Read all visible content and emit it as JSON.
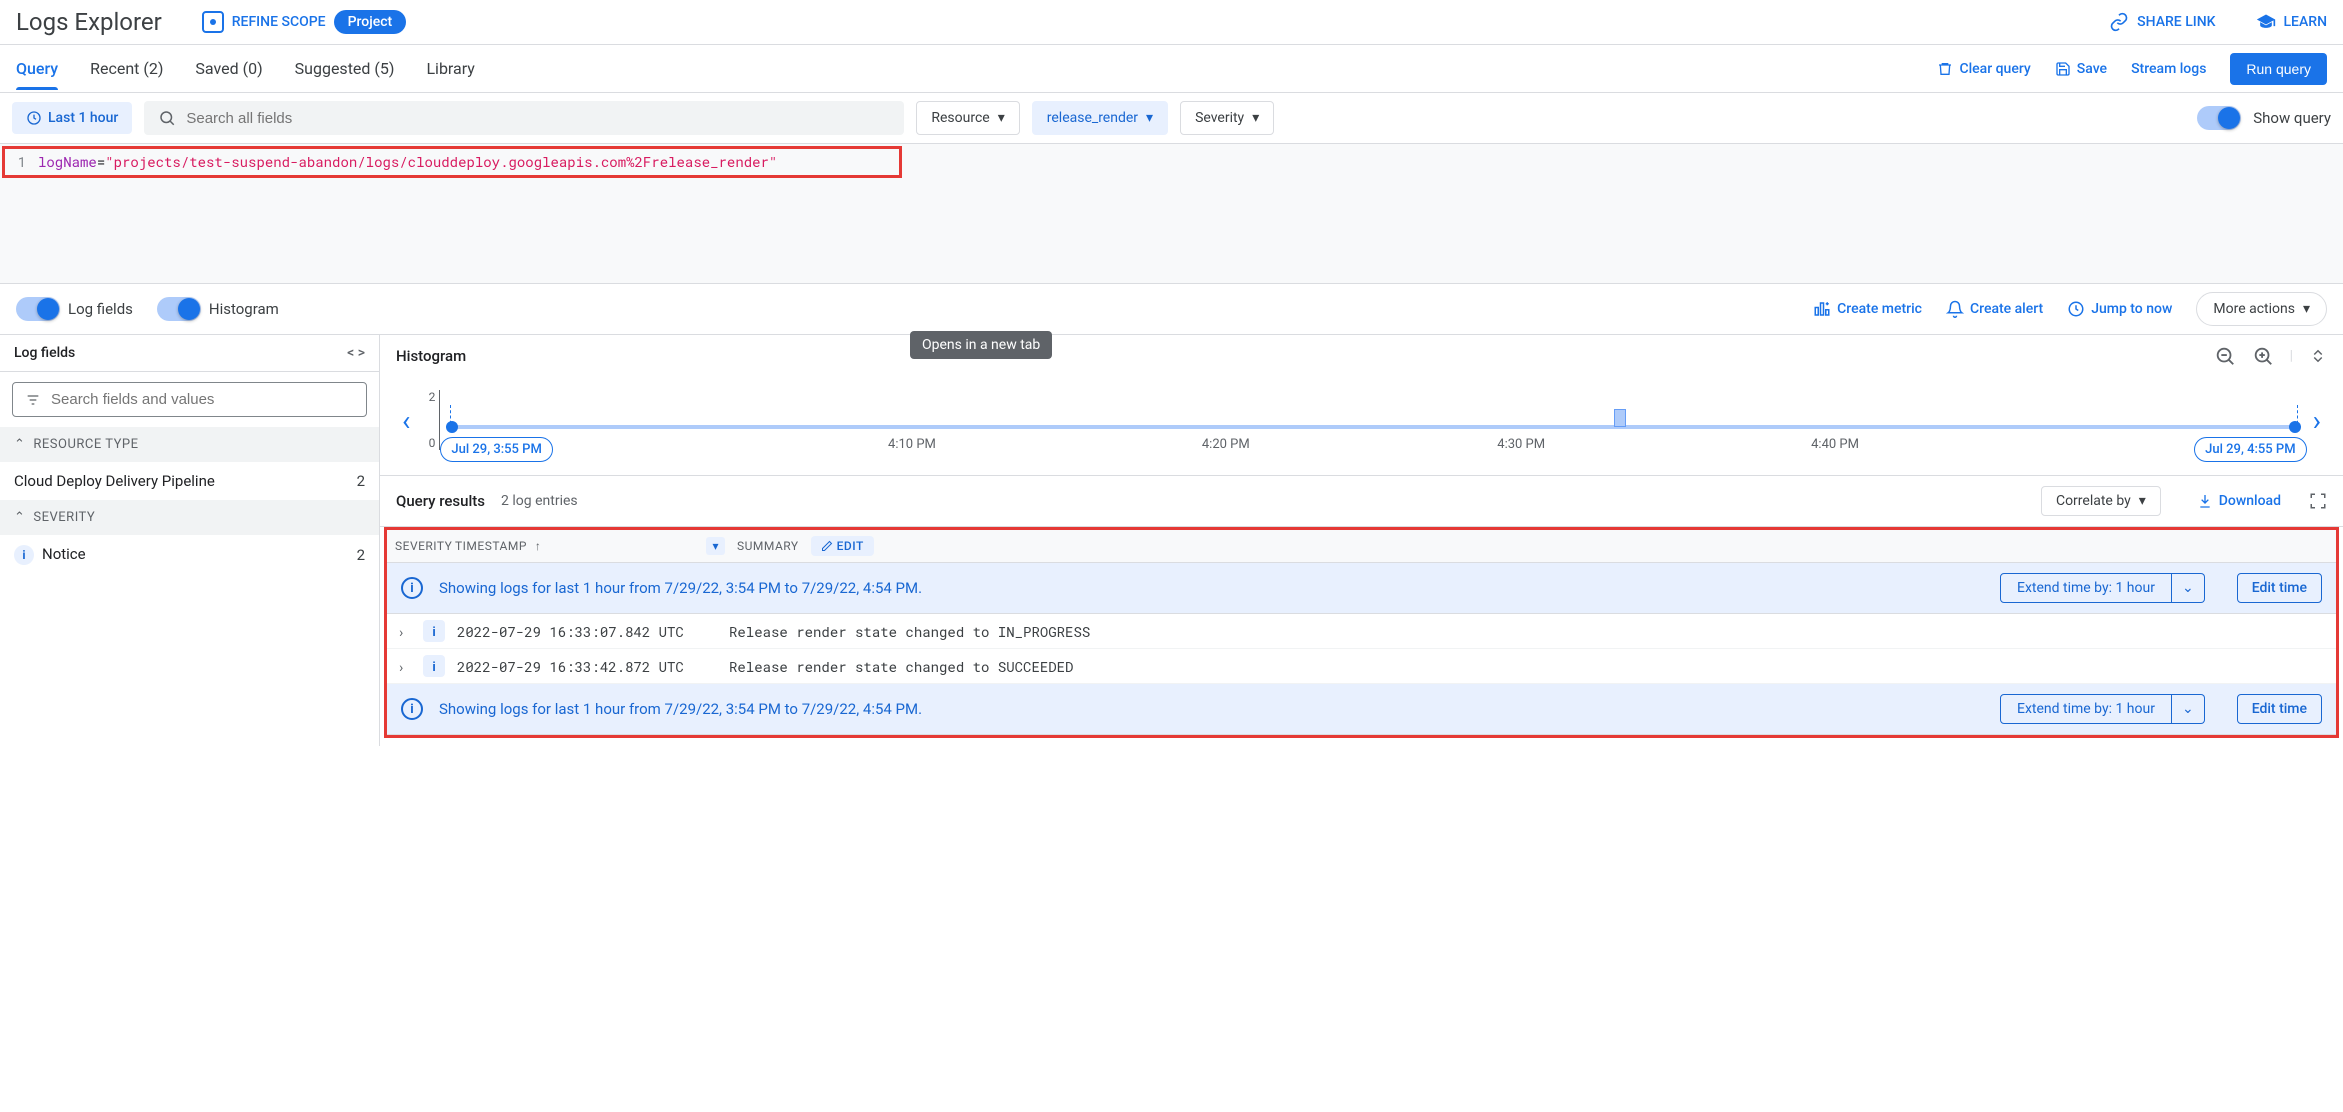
{
  "header": {
    "title": "Logs Explorer",
    "refine_scope": "REFINE SCOPE",
    "project_chip": "Project",
    "share_link": "SHARE LINK",
    "learn": "LEARN"
  },
  "tabs": {
    "query": "Query",
    "recent": "Recent (2)",
    "saved": "Saved (0)",
    "suggested": "Suggested (5)",
    "library": "Library"
  },
  "tabs_actions": {
    "clear_query": "Clear query",
    "save": "Save",
    "stream_logs": "Stream logs",
    "run_query": "Run query"
  },
  "filters": {
    "time_chip": "Last 1 hour",
    "search_placeholder": "Search all fields",
    "resource": "Resource",
    "log_name": "release_render",
    "severity": "Severity",
    "show_query": "Show query"
  },
  "query": {
    "line_num": "1",
    "keyword": "logName",
    "eq": "=",
    "value": "\"projects/test-suspend-abandon/logs/clouddeploy.googleapis.com%2Frelease_render\""
  },
  "toolbar": {
    "log_fields": "Log fields",
    "histogram": "Histogram",
    "create_metric": "Create metric",
    "create_alert": "Create alert",
    "jump_to_now": "Jump to now",
    "more_actions": "More actions"
  },
  "sidebar": {
    "title": "Log fields",
    "search_placeholder": "Search fields and values",
    "resource_type_header": "RESOURCE TYPE",
    "resource_type_value": "Cloud Deploy Delivery Pipeline",
    "resource_type_count": "2",
    "severity_header": "SEVERITY",
    "severity_value": "Notice",
    "severity_count": "2"
  },
  "histogram": {
    "title": "Histogram",
    "y_max": "2",
    "y_min": "0",
    "start_label": "Jul 29, 3:55 PM",
    "end_label": "Jul 29, 4:55 PM",
    "ticks": [
      "4:10 PM",
      "4:20 PM",
      "4:30 PM",
      "4:40 PM"
    ],
    "tooltip": "Opens in a new tab"
  },
  "results": {
    "title": "Query results",
    "count": "2 log entries",
    "correlate": "Correlate by",
    "download": "Download",
    "col_severity": "SEVERITY",
    "col_timestamp": "TIMESTAMP",
    "col_summary": "SUMMARY",
    "edit": "EDIT",
    "banner_text": "Showing logs for last 1 hour from 7/29/22, 3:54 PM to 7/29/22, 4:54 PM.",
    "extend_label": "Extend time by: 1 hour",
    "edit_time": "Edit time",
    "rows": [
      {
        "ts": "2022-07-29 16:33:07.842 UTC",
        "summary": "Release render state changed to IN_PROGRESS"
      },
      {
        "ts": "2022-07-29 16:33:42.872 UTC",
        "summary": "Release render state changed to SUCCEEDED"
      }
    ]
  }
}
